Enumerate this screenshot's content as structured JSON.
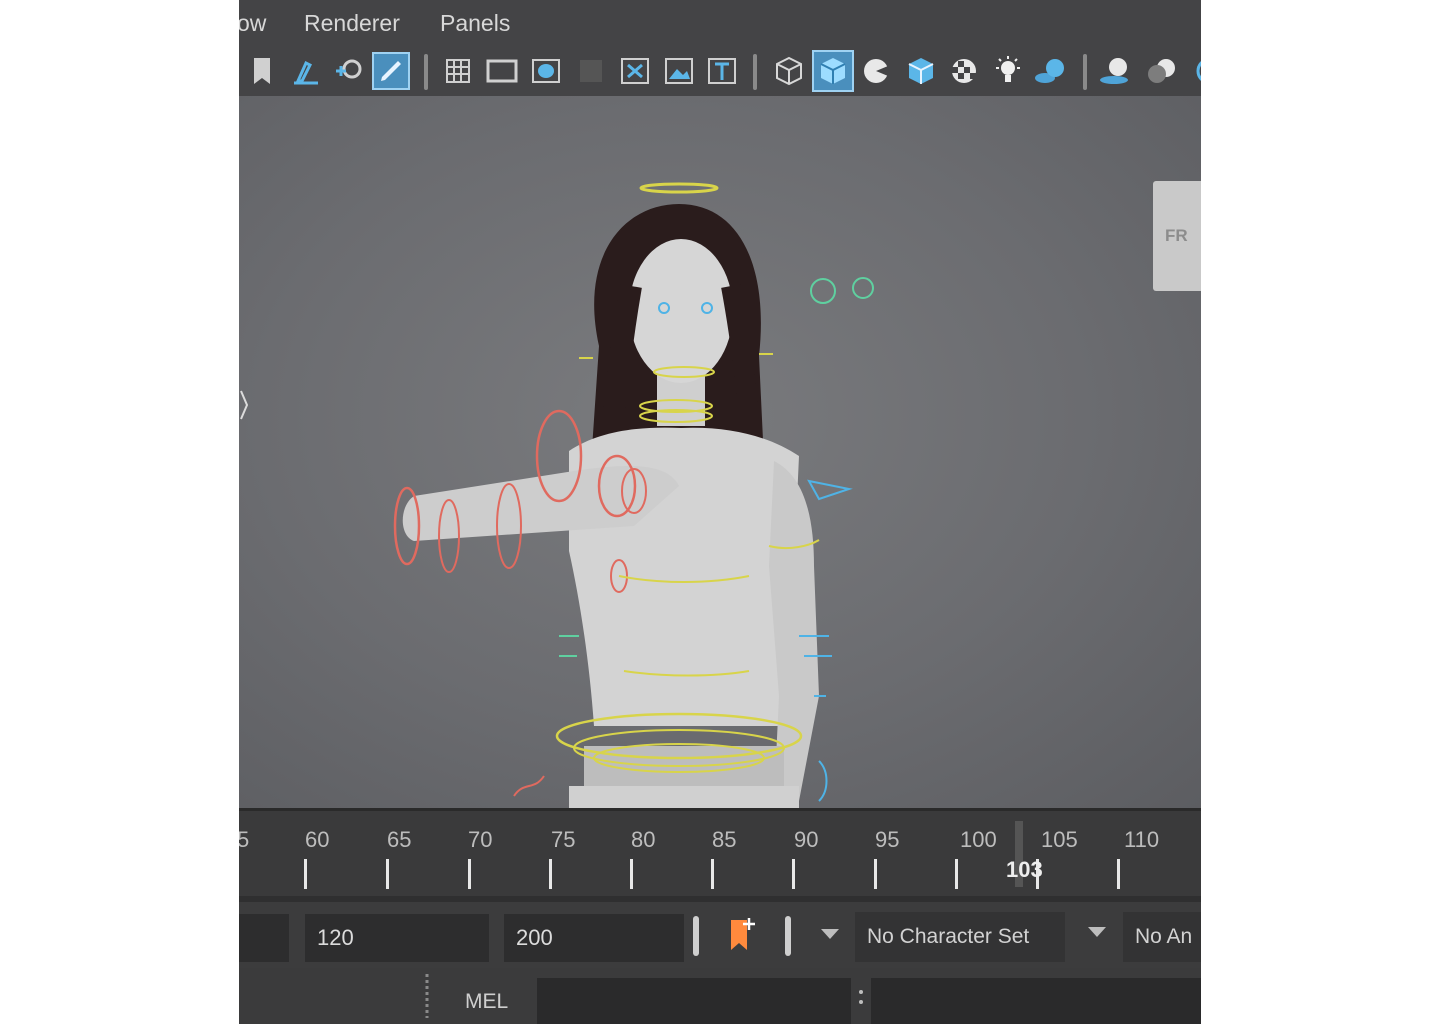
{
  "menu": {
    "items": [
      "ow",
      "Renderer",
      "Panels"
    ]
  },
  "toolbar": {
    "icons": [
      "bookmark-icon",
      "paint-select-icon",
      "lasso-icon",
      "pencil-icon",
      "grid-icon",
      "film-gate-icon",
      "resolution-gate-icon",
      "safe-area-icon",
      "field-chart-icon",
      "image-plane-icon",
      "camera-attributes-icon",
      "wireframe-icon",
      "smooth-shade-icon",
      "default-material-icon",
      "textured-icon",
      "checker-icon",
      "lights-icon",
      "shadows-icon",
      "ambient-occlusion-icon",
      "motion-blur-icon"
    ]
  },
  "viewport": {
    "viewcube_label": "FR"
  },
  "timeline": {
    "labels": [
      "5",
      "60",
      "65",
      "70",
      "75",
      "80",
      "85",
      "90",
      "95",
      "100",
      "105",
      "110"
    ],
    "current_frame": "103"
  },
  "range": {
    "end_time": "120",
    "max_time": "200",
    "character_set": "No Character Set",
    "anim_layer": "No An"
  },
  "command": {
    "mode_label": "MEL"
  },
  "colors": {
    "accent": "#4a8fbd",
    "ctrl_red": "#e06a5f",
    "ctrl_yellow": "#d8d44a",
    "ctrl_blue": "#4fb3e6",
    "ctrl_green": "#5fd0a0"
  }
}
